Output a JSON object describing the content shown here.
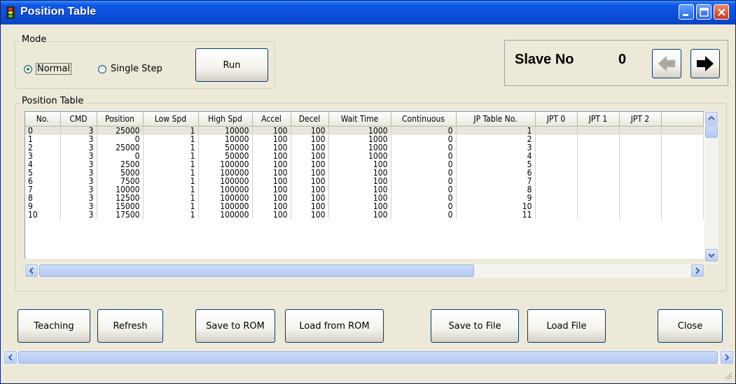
{
  "window": {
    "title": "Position Table"
  },
  "mode": {
    "label": "Mode",
    "normal_label": "Normal",
    "single_step_label": "Single Step",
    "selected": "Normal",
    "run_label": "Run"
  },
  "slave": {
    "label": "Slave No",
    "number": "0"
  },
  "table": {
    "label": "Position Table",
    "columns": [
      "No.",
      "CMD",
      "Position",
      "Low Spd",
      "High Spd",
      "Accel",
      "Decel",
      "Wait Time",
      "Continuous",
      "JP Table No.",
      "JPT 0",
      "JPT 1",
      "JPT 2",
      ""
    ],
    "rows": [
      [
        "0",
        "3",
        "25000",
        "1",
        "10000",
        "100",
        "100",
        "1000",
        "0",
        "1"
      ],
      [
        "1",
        "3",
        "0",
        "1",
        "10000",
        "100",
        "100",
        "1000",
        "0",
        "2"
      ],
      [
        "2",
        "3",
        "25000",
        "1",
        "50000",
        "100",
        "100",
        "1000",
        "0",
        "3"
      ],
      [
        "3",
        "3",
        "0",
        "1",
        "50000",
        "100",
        "100",
        "1000",
        "0",
        "4"
      ],
      [
        "4",
        "3",
        "2500",
        "1",
        "100000",
        "100",
        "100",
        "100",
        "0",
        "5"
      ],
      [
        "5",
        "3",
        "5000",
        "1",
        "100000",
        "100",
        "100",
        "100",
        "0",
        "6"
      ],
      [
        "6",
        "3",
        "7500",
        "1",
        "100000",
        "100",
        "100",
        "100",
        "0",
        "7"
      ],
      [
        "7",
        "3",
        "10000",
        "1",
        "100000",
        "100",
        "100",
        "100",
        "0",
        "8"
      ],
      [
        "8",
        "3",
        "12500",
        "1",
        "100000",
        "100",
        "100",
        "100",
        "0",
        "9"
      ],
      [
        "9",
        "3",
        "15000",
        "1",
        "100000",
        "100",
        "100",
        "100",
        "0",
        "10"
      ],
      [
        "10",
        "3",
        "17500",
        "1",
        "100000",
        "100",
        "100",
        "100",
        "0",
        "11"
      ]
    ],
    "selected_row": 0
  },
  "buttons": {
    "teaching": "Teaching",
    "refresh": "Refresh",
    "save_rom": "Save to ROM",
    "load_rom": "Load from ROM",
    "save_file": "Save to File",
    "load_file": "Load File",
    "close": "Close"
  },
  "colors": {
    "titlebar": "#0A4FD8",
    "face": "#ECE9D8",
    "button_border": "#003C74",
    "radio_dot": "#21A121"
  },
  "icons": [
    "traffic-light-icon",
    "minimize-icon",
    "maximize-icon",
    "close-icon",
    "arrow-left-icon",
    "arrow-right-icon",
    "scroll-up-icon",
    "scroll-down-icon",
    "scroll-left-icon",
    "scroll-right-icon"
  ]
}
